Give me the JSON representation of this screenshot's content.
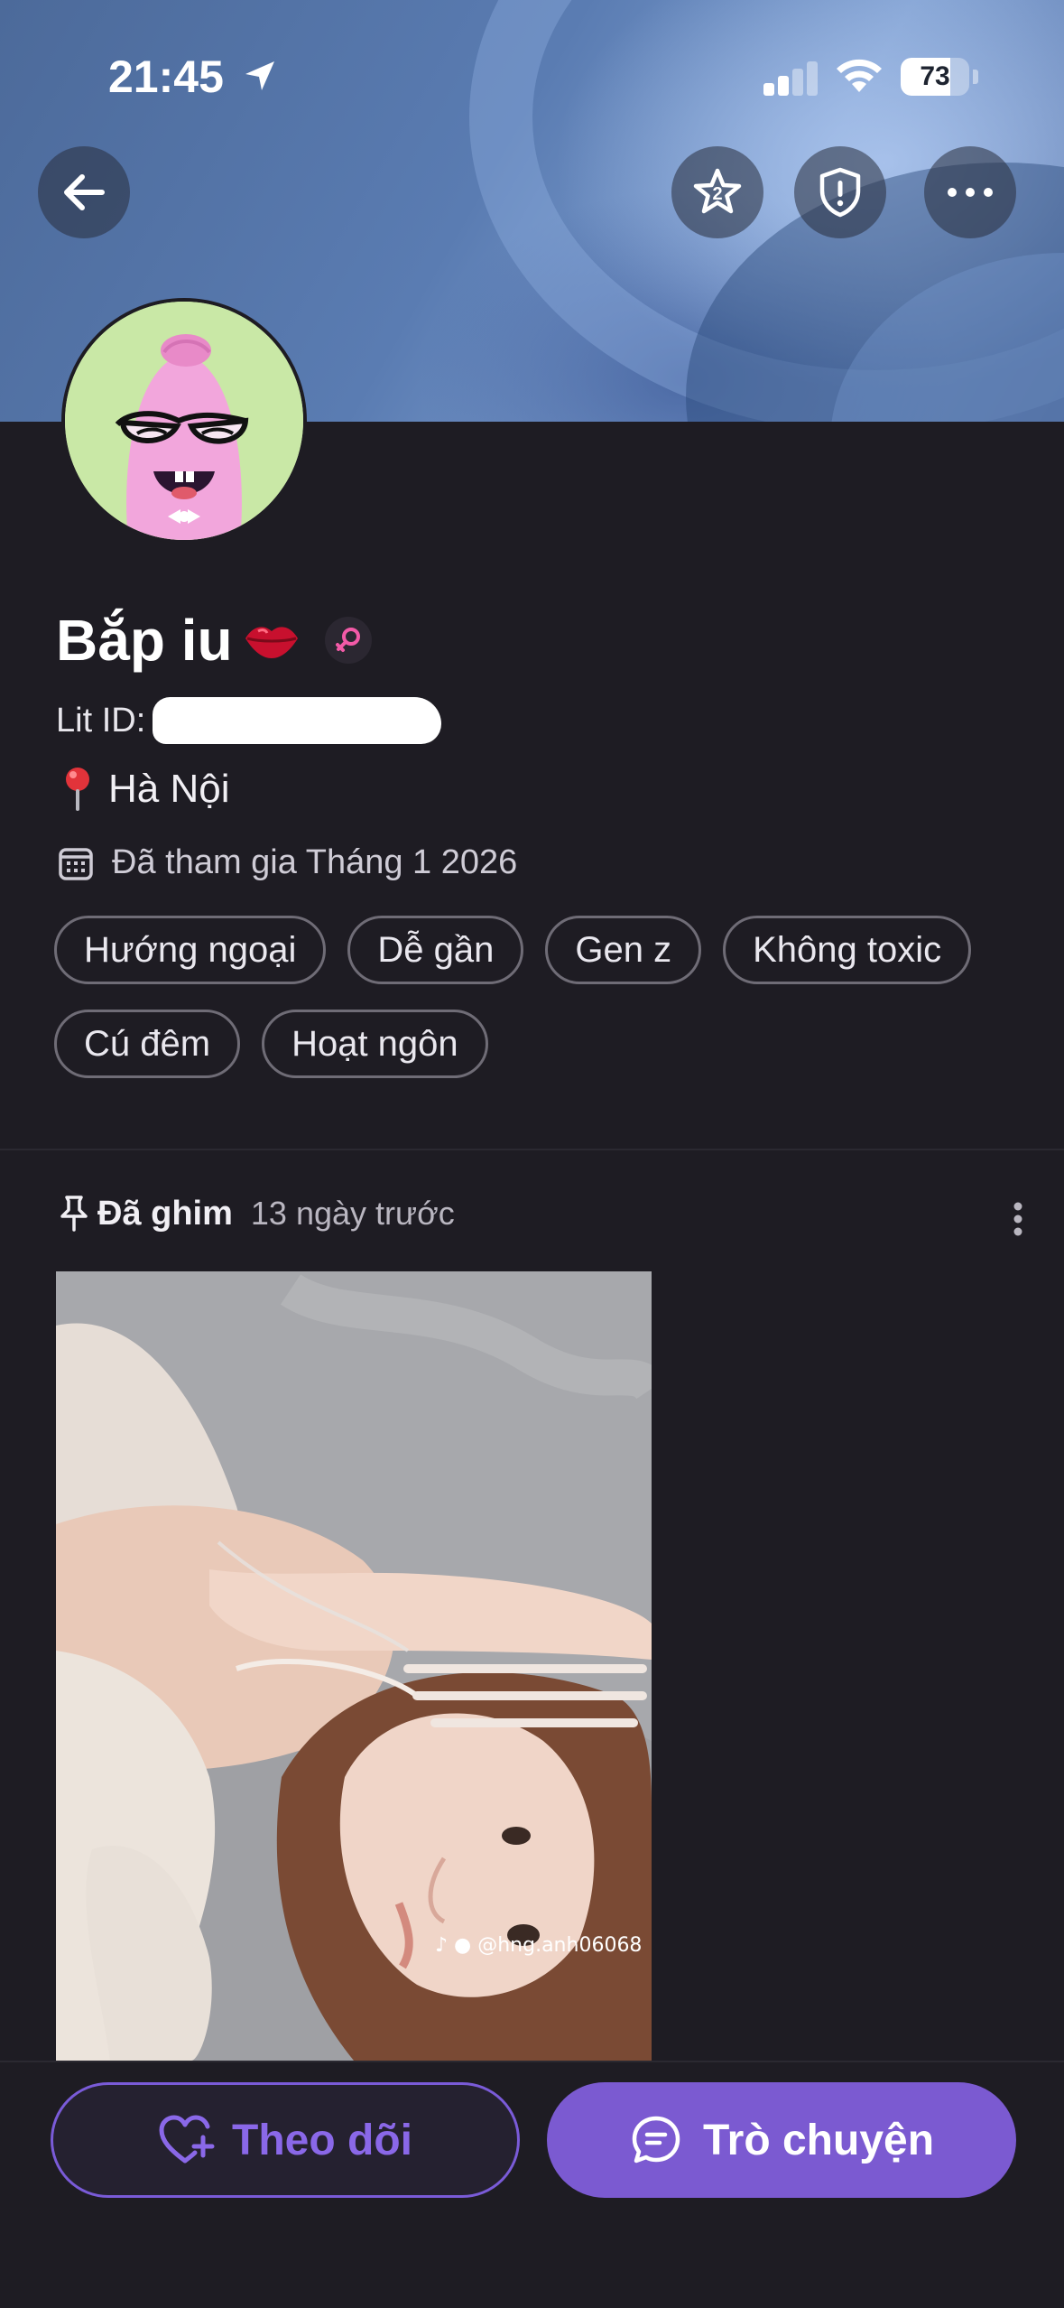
{
  "status_bar": {
    "time": "21:45",
    "battery_percent": "73",
    "battery_level": 0.73,
    "signal_bars_active": 2,
    "signal_bars_total": 4
  },
  "header": {
    "back_icon": "arrow-left-icon",
    "actions": [
      {
        "name": "star-badge-icon"
      },
      {
        "name": "shield-alert-icon"
      },
      {
        "name": "more-horizontal-icon"
      }
    ]
  },
  "profile": {
    "name": "Bắp iu",
    "name_emoji": "lips-emoji",
    "gender_icon": "female-symbol-icon",
    "lit_id_label": "Lit ID:",
    "location": "Hà Nội",
    "joined": "Đã tham gia Tháng 1 2026",
    "tags": [
      "Hướng ngoại",
      "Dễ gần",
      "Gen z",
      "Không toxic",
      "Cú đêm",
      "Hoạt ngôn"
    ]
  },
  "pinned_post": {
    "label": "Đã ghim",
    "time": "13 ngày trước",
    "watermark": "@hng.anh06068"
  },
  "actions": {
    "follow_label": "Theo dõi",
    "chat_label": "Trò chuyện"
  },
  "colors": {
    "background": "#1e1c23",
    "accent": "#7b5ad1",
    "follow_text": "#8a68e8",
    "tag_border": "#6f6c76"
  }
}
